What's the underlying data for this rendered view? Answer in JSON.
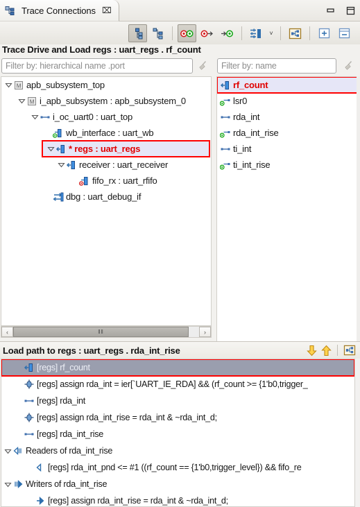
{
  "window": {
    "tab_title": "Trace Connections",
    "tab_icon": "hierarchy-icon",
    "close_label": "⌧",
    "minimize_label": "minimize-icon",
    "maximize_label": "maximize-icon"
  },
  "toolbar": {
    "buttons": [
      {
        "name": "show-hierarchy-down",
        "icon": "hierarchy-down-icon",
        "pressed": true
      },
      {
        "name": "show-hierarchy-up",
        "icon": "hierarchy-up-icon",
        "pressed": false
      },
      {
        "name": "show-drivers-and-loads",
        "icon": "drivers-loads-icon",
        "pressed": true
      },
      {
        "name": "show-drivers",
        "icon": "drivers-icon",
        "pressed": false
      },
      {
        "name": "show-loads",
        "icon": "loads-icon",
        "pressed": false
      },
      {
        "name": "filter-settings",
        "icon": "filter-settings-icon",
        "pressed": false
      },
      {
        "name": "link-with-editor",
        "icon": "link-editor-icon",
        "pressed": false
      },
      {
        "name": "expand-all",
        "icon": "expand-all-icon",
        "pressed": false
      },
      {
        "name": "collapse-all",
        "icon": "collapse-all-icon",
        "pressed": false
      }
    ],
    "dropdown_caret": "˅"
  },
  "header": {
    "title": "Trace Drive and Load regs : uart_regs . rf_count"
  },
  "filters": {
    "left_placeholder": "Filter by: hierarchical name .port",
    "left_value": "",
    "right_placeholder": "Filter by: name",
    "right_value": "",
    "clear_left_icon": "broom-clear-icon",
    "clear_right_icon": "broom-clear-icon"
  },
  "hierarchy_tree": {
    "nodes": [
      {
        "label": "apb_subsystem_top",
        "indent": 0,
        "expander": "expanded",
        "icon": "module-icon",
        "selected": false
      },
      {
        "label": "i_apb_subsystem : apb_subsystem_0",
        "indent": 1,
        "expander": "expanded",
        "icon": "module-icon",
        "selected": false
      },
      {
        "label": "i_oc_uart0 : uart_top",
        "indent": 2,
        "expander": "expanded",
        "icon": "port-icon",
        "selected": false
      },
      {
        "label": "wb_interface : uart_wb",
        "indent": 3,
        "expander": "none",
        "icon": "driver-load-icon",
        "selected": false
      },
      {
        "label": "* regs : uart_regs",
        "indent": 3,
        "expander": "expanded",
        "icon": "load-icon",
        "selected": true
      },
      {
        "label": "receiver : uart_receiver",
        "indent": 4,
        "expander": "expanded",
        "icon": "load-icon",
        "selected": false
      },
      {
        "label": "fifo_rx : uart_rfifo",
        "indent": 5,
        "expander": "none",
        "icon": "driver-icon",
        "selected": false
      },
      {
        "label": "dbg : uart_debug_if",
        "indent": 3,
        "expander": "none",
        "icon": "interface-icon",
        "selected": false
      }
    ]
  },
  "signal_list": {
    "items": [
      {
        "label": "rf_count",
        "icon": "load-icon",
        "selected": true
      },
      {
        "label": "lsr0",
        "icon": "driver-port-icon",
        "selected": false
      },
      {
        "label": "rda_int",
        "icon": "net-icon",
        "selected": false
      },
      {
        "label": "rda_int_rise",
        "icon": "driver-port-icon",
        "selected": false
      },
      {
        "label": "ti_int",
        "icon": "net-icon",
        "selected": false
      },
      {
        "label": "ti_int_rise",
        "icon": "driver-port-icon",
        "selected": false
      }
    ]
  },
  "hscrollbar": {
    "left_arrow": "‹",
    "right_arrow": "›",
    "grip": "‖‖"
  },
  "load_path_panel": {
    "title": "Load path to regs : uart_regs . rda_int_rise",
    "tools": [
      {
        "name": "next-match-button",
        "icon": "arrow-down-icon"
      },
      {
        "name": "previous-match-button",
        "icon": "arrow-up-icon"
      },
      {
        "name": "link-with-editor-button",
        "icon": "link-editor-icon"
      }
    ],
    "rows": [
      {
        "label": "[regs] rf_count",
        "indent": 1,
        "expander": "none",
        "icon": "load-icon",
        "selected": true
      },
      {
        "label": "[regs] assign rda_int = ier[`UART_IE_RDA] && (rf_count >= {1'b0,trigger_",
        "indent": 1,
        "expander": "none",
        "icon": "assign-icon",
        "selected": false
      },
      {
        "label": "[regs] rda_int",
        "indent": 1,
        "expander": "none",
        "icon": "net-icon",
        "selected": false
      },
      {
        "label": "[regs] assign rda_int_rise = rda_int & ~rda_int_d;",
        "indent": 1,
        "expander": "none",
        "icon": "assign-icon",
        "selected": false
      },
      {
        "label": "[regs] rda_int_rise",
        "indent": 1,
        "expander": "none",
        "icon": "net-icon",
        "selected": false
      },
      {
        "label": "Readers of rda_int_rise",
        "indent": 0,
        "expander": "expanded",
        "icon": "readers-icon",
        "selected": false
      },
      {
        "label": "[regs] rda_int_pnd <= #1 ((rf_count == {1'b0,trigger_level}) && fifo_re",
        "indent": 2,
        "expander": "none",
        "icon": "reader-icon",
        "selected": false
      },
      {
        "label": "Writers of rda_int_rise",
        "indent": 0,
        "expander": "expanded",
        "icon": "writers-icon",
        "selected": false
      },
      {
        "label": "[regs] assign rda_int_rise = rda_int & ~rda_int_d;",
        "indent": 2,
        "expander": "none",
        "icon": "writer-icon",
        "selected": false
      }
    ]
  },
  "colors": {
    "selection_red": "#ff0000",
    "selected_text": "#e00000",
    "selected_bg": "#e6e6f7",
    "bottom_selected_bg": "#9a9eae",
    "panel_bg": "#f2f1ee",
    "list_bg": "#ffffff"
  }
}
